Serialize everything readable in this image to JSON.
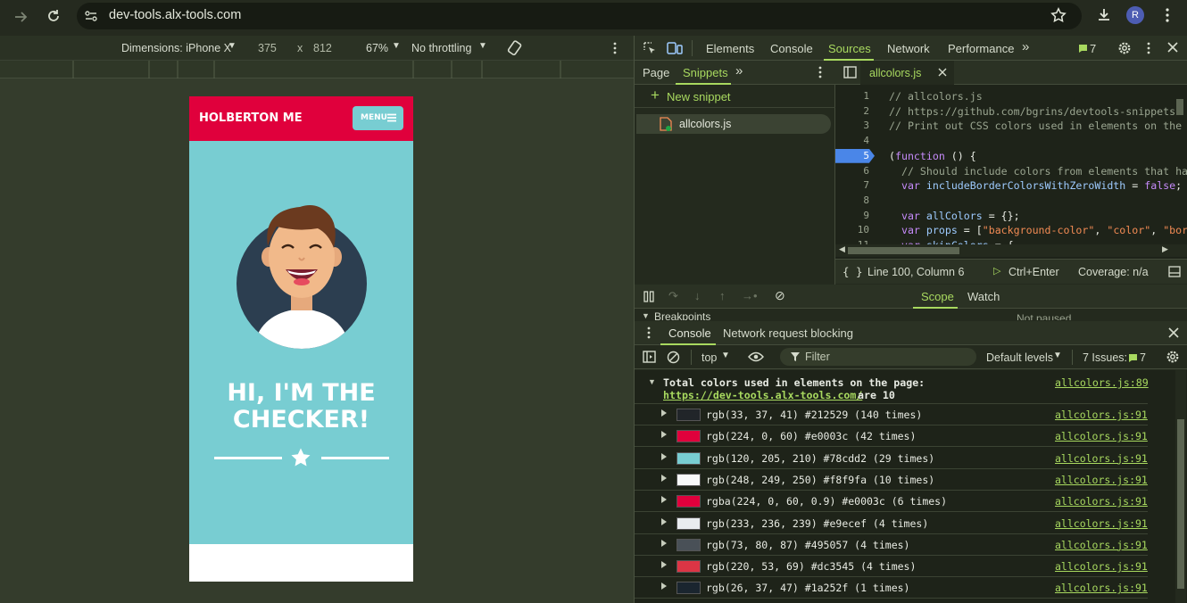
{
  "browser": {
    "url": "dev-tools.alx-tools.com",
    "profile_initial": "R"
  },
  "device_toolbar": {
    "dimensions_label": "Dimensions: iPhone X",
    "width": "375",
    "times": "x",
    "height": "812",
    "zoom": "67%",
    "throttle": "No throttling"
  },
  "page": {
    "brand": "HOLBERTON ME",
    "menu_label": "MENU",
    "hero_line1": "HI, I'M THE",
    "hero_line2": "CHECKER!"
  },
  "devtools": {
    "tabs": [
      "Elements",
      "Console",
      "Sources",
      "Network",
      "Performance"
    ],
    "active_tab": "Sources",
    "issues_badge": "7",
    "nav_tabs": [
      "Page",
      "Snippets"
    ],
    "new_snippet": "New snippet",
    "snippet_file": "allcolors.js",
    "editor_tab": "allcolors.js",
    "code_lines": [
      {
        "n": "1",
        "t": "// allcolors.js"
      },
      {
        "n": "2",
        "t": "// https://github.com/bgrins/devtools-snippets"
      },
      {
        "n": "3",
        "t": "// Print out CSS colors used in elements on the"
      },
      {
        "n": "4",
        "t": ""
      },
      {
        "n": "5",
        "t": "(function () {"
      },
      {
        "n": "6",
        "t": "  // Should include colors from elements that hav"
      },
      {
        "n": "7",
        "t": "  var includeBorderColorsWithZeroWidth = false;"
      },
      {
        "n": "8",
        "t": ""
      },
      {
        "n": "9",
        "t": "  var allColors = {};"
      },
      {
        "n": "10",
        "t": "  var props = [\"background-color\", \"color\", \"bor"
      },
      {
        "n": "11",
        "t": "  var skipColors = {"
      }
    ],
    "status": {
      "position": "Line 100, Column 6",
      "run": "Ctrl+Enter",
      "coverage": "Coverage: n/a"
    },
    "debugger_tabs": [
      "Scope",
      "Watch"
    ],
    "breakpoints_label": "Breakpoints",
    "not_paused": "Not paused"
  },
  "console": {
    "drawer_tabs": [
      "Console",
      "Network request blocking"
    ],
    "context": "top",
    "filter_placeholder": "Filter",
    "levels": "Default levels",
    "issues_label": "7 Issues:",
    "issues_count": "7",
    "header_text": "Total colors used in elements on the page:",
    "header_link": "https://dev-tools.alx-tools.com/",
    "header_suffix": " are 10",
    "header_source": "allcolors.js:89",
    "rows": [
      {
        "text": "rgb(33, 37, 41) #212529 (140 times)",
        "color": "#212529",
        "source": "allcolors.js:91"
      },
      {
        "text": "rgb(224, 0, 60) #e0003c (42 times)",
        "color": "#e0003c",
        "source": "allcolors.js:91"
      },
      {
        "text": "rgb(120, 205, 210) #78cdd2 (29 times)",
        "color": "#78cdd2",
        "source": "allcolors.js:91"
      },
      {
        "text": "rgb(248, 249, 250) #f8f9fa (10 times)",
        "color": "#f8f9fa",
        "source": "allcolors.js:91"
      },
      {
        "text": "rgba(224, 0, 60, 0.9) #e0003c (6 times)",
        "color": "#e0003c",
        "source": "allcolors.js:91"
      },
      {
        "text": "rgb(233, 236, 239) #e9ecef (4 times)",
        "color": "#e9ecef",
        "source": "allcolors.js:91"
      },
      {
        "text": "rgb(73, 80, 87) #495057 (4 times)",
        "color": "#495057",
        "source": "allcolors.js:91"
      },
      {
        "text": "rgb(220, 53, 69) #dc3545 (4 times)",
        "color": "#dc3545",
        "source": "allcolors.js:91"
      },
      {
        "text": "rgb(26, 37, 47) #1a252f (1 times)",
        "color": "#1a252f",
        "source": "allcolors.js:91"
      }
    ]
  }
}
